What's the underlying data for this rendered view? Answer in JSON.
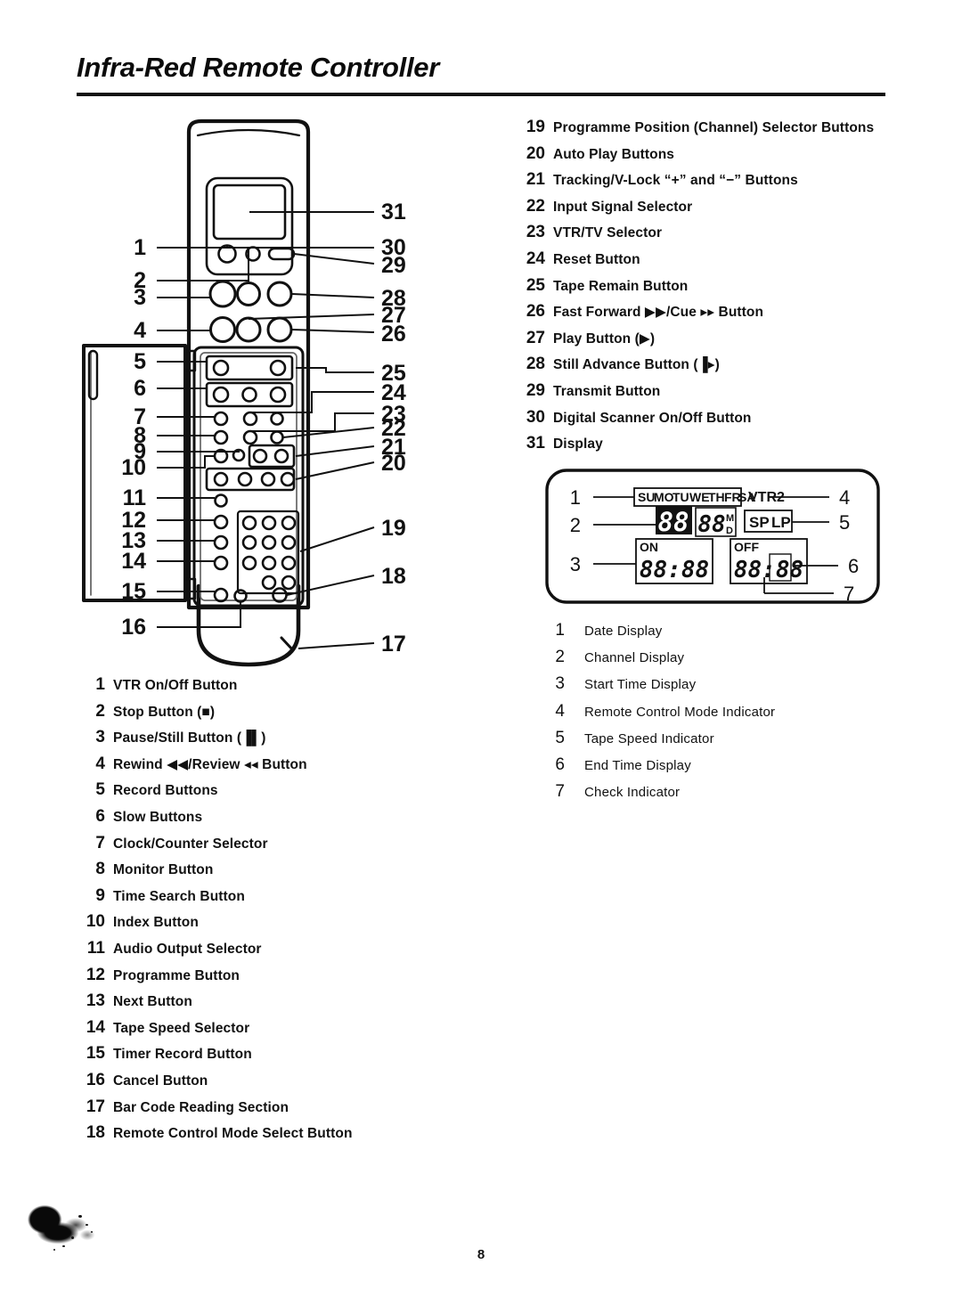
{
  "document": {
    "title": "Infra-Red Remote Controller",
    "page_number": "8"
  },
  "remote_parts_left": [
    {
      "num": "1",
      "label": "VTR On/Off Button"
    },
    {
      "num": "2",
      "label": "Stop Button (■)"
    },
    {
      "num": "3",
      "label": "Pause/Still Button (▐▌)"
    },
    {
      "num": "4",
      "label": "Rewind ◀◀/Review ◂◂ Button"
    },
    {
      "num": "5",
      "label": "Record Buttons"
    },
    {
      "num": "6",
      "label": "Slow Buttons"
    },
    {
      "num": "7",
      "label": "Clock/Counter Selector"
    },
    {
      "num": "8",
      "label": "Monitor Button"
    },
    {
      "num": "9",
      "label": "Time Search Button"
    },
    {
      "num": "10",
      "label": "Index Button"
    },
    {
      "num": "11",
      "label": "Audio Output Selector"
    },
    {
      "num": "12",
      "label": "Programme Button"
    },
    {
      "num": "13",
      "label": "Next Button"
    },
    {
      "num": "14",
      "label": "Tape Speed Selector"
    },
    {
      "num": "15",
      "label": "Timer Record Button"
    },
    {
      "num": "16",
      "label": "Cancel Button"
    },
    {
      "num": "17",
      "label": "Bar Code Reading Section"
    },
    {
      "num": "18",
      "label": "Remote Control Mode Select Button"
    }
  ],
  "remote_parts_right": [
    {
      "num": "19",
      "label": "Programme Position (Channel) Selector Buttons"
    },
    {
      "num": "20",
      "label": "Auto Play Buttons"
    },
    {
      "num": "21",
      "label": "Tracking/V-Lock “+” and “−” Buttons"
    },
    {
      "num": "22",
      "label": "Input Signal Selector"
    },
    {
      "num": "23",
      "label": "VTR/TV Selector"
    },
    {
      "num": "24",
      "label": "Reset Button"
    },
    {
      "num": "25",
      "label": "Tape Remain Button"
    },
    {
      "num": "26",
      "label": "Fast Forward ▶▶/Cue ▸▸ Button"
    },
    {
      "num": "27",
      "label": "Play Button (▶)"
    },
    {
      "num": "28",
      "label": "Still Advance Button (▐▸)"
    },
    {
      "num": "29",
      "label": "Transmit Button"
    },
    {
      "num": "30",
      "label": "Digital Scanner On/Off Button"
    },
    {
      "num": "31",
      "label": "Display"
    }
  ],
  "display_parts": [
    {
      "num": "1",
      "label": "Date Display"
    },
    {
      "num": "2",
      "label": "Channel Display"
    },
    {
      "num": "3",
      "label": "Start Time Display"
    },
    {
      "num": "4",
      "label": "Remote Control Mode Indicator"
    },
    {
      "num": "5",
      "label": "Tape Speed Indicator"
    },
    {
      "num": "6",
      "label": "End Time Display"
    },
    {
      "num": "7",
      "label": "Check Indicator"
    }
  ],
  "remote_callouts_left": [
    "1",
    "2",
    "3",
    "4",
    "5",
    "6",
    "7",
    "8",
    "9",
    "10",
    "11",
    "12",
    "13",
    "14",
    "15",
    "16"
  ],
  "remote_callouts_right": [
    "31",
    "30",
    "29",
    "28",
    "27",
    "26",
    "25",
    "24",
    "23",
    "22",
    "21",
    "20",
    "19",
    "18",
    "17"
  ],
  "display_diagram": {
    "day_labels": [
      "SU",
      "MO",
      "TU",
      "WE",
      "TH",
      "FR",
      "SA"
    ],
    "mode_indicator": "VTR2",
    "tape_speed": [
      "SP",
      "LP"
    ],
    "channel_digits": "88",
    "date_digits": "88",
    "date_unit_top": "M",
    "date_unit_bottom": "D",
    "on_label": "ON",
    "off_label": "OFF",
    "on_time": "88:88",
    "off_time": "88:88",
    "callouts_left": [
      "1",
      "2",
      "3"
    ],
    "callouts_right": [
      "4",
      "5",
      "6",
      "7"
    ]
  },
  "colors": {
    "ink": "#111111",
    "paper": "#ffffff",
    "rule": "#121212"
  }
}
